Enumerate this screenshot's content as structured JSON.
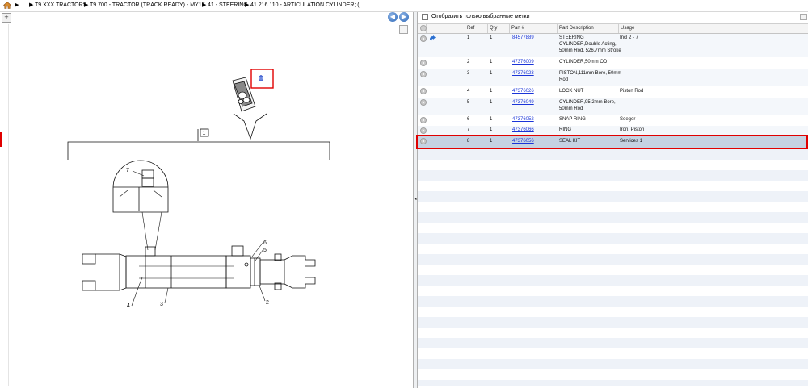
{
  "breadcrumb": {
    "items": [
      "...",
      "T9.XXX TRACTORS",
      "T9.700 - TRACTOR (TRACK READY) - MY17 ...",
      "41 - STEERING",
      "41.216.110 - ARTICULATION CYLINDER; (..."
    ],
    "separator": "▶"
  },
  "toolbar": {
    "prev_icon": "◀",
    "next_icon": "▶",
    "zoom_icon": "+"
  },
  "diagram": {
    "callouts": [
      "1",
      "2",
      "3",
      "4",
      "5",
      "6",
      "7"
    ]
  },
  "splitter": {
    "grip_icon": "◂"
  },
  "filter": {
    "label": "Отобразить только выбранные метки"
  },
  "table": {
    "columns": [
      "Ref",
      "Qty",
      "Part #",
      "Part Description",
      "Usage"
    ],
    "rows": [
      {
        "ref": "1",
        "qty": "1",
        "part": "84577889",
        "desc": [
          "STEERING",
          "CYLINDER,Double Acting,",
          "50mm Rod, 526.7mm Stroke"
        ],
        "usage": "Incl 2 - 7"
      },
      {
        "ref": "2",
        "qty": "1",
        "part": "47376009",
        "desc": [
          "CYLINDER,50mm OD"
        ],
        "usage": ""
      },
      {
        "ref": "3",
        "qty": "1",
        "part": "47376023",
        "desc": [
          "PISTON,111mm Bore, 50mm",
          "Rod"
        ],
        "usage": ""
      },
      {
        "ref": "4",
        "qty": "1",
        "part": "47376026",
        "desc": [
          "LOCK NUT"
        ],
        "usage": "Piston Rod"
      },
      {
        "ref": "5",
        "qty": "1",
        "part": "47376049",
        "desc": [
          "CYLINDER,95.2mm Bore,",
          "50mm Rod"
        ],
        "usage": ""
      },
      {
        "ref": "6",
        "qty": "1",
        "part": "47376052",
        "desc": [
          "SNAP RING"
        ],
        "usage": "Seeger"
      },
      {
        "ref": "7",
        "qty": "1",
        "part": "47376066",
        "desc": [
          "RING"
        ],
        "usage": "Iron, Piston"
      },
      {
        "ref": "8",
        "qty": "1",
        "part": "47376056",
        "desc": [
          "SEAL KIT"
        ],
        "usage": "Services 1"
      }
    ],
    "selected_ref": "8"
  },
  "colors": {
    "highlight": "#e00000",
    "link": "#1a34d8",
    "selected_row": "#c5d2e2",
    "nav_button": "#2d68b8"
  }
}
